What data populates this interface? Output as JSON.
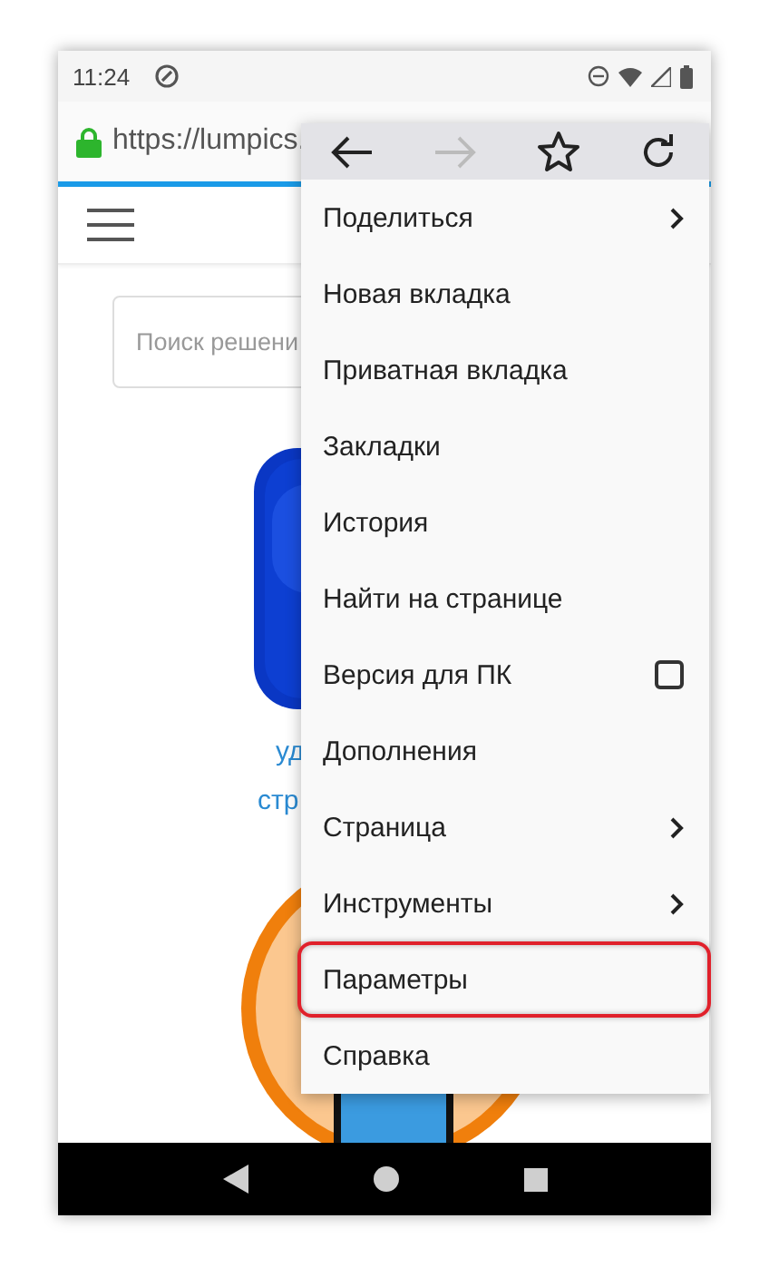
{
  "status_bar": {
    "time": "11:24"
  },
  "address_bar": {
    "url": "https://lumpics."
  },
  "page": {
    "search": {
      "placeholder": "Поиск решени"
    },
    "link_lines": [
      "уд",
      "стр"
    ]
  },
  "menu": {
    "toolbar": [
      {
        "kind": "back",
        "disabled": false
      },
      {
        "kind": "forward",
        "disabled": true
      },
      {
        "kind": "bookmark",
        "disabled": false
      },
      {
        "kind": "reload",
        "disabled": false
      }
    ],
    "items": [
      {
        "label": "Поделиться",
        "kind": "submenu",
        "highlighted": false
      },
      {
        "label": "Новая вкладка",
        "kind": "plain",
        "highlighted": false
      },
      {
        "label": "Приватная вкладка",
        "kind": "plain",
        "highlighted": false
      },
      {
        "label": "Закладки",
        "kind": "plain",
        "highlighted": false
      },
      {
        "label": "История",
        "kind": "plain",
        "highlighted": false
      },
      {
        "label": "Найти на странице",
        "kind": "plain",
        "highlighted": false
      },
      {
        "label": "Версия для ПК",
        "kind": "checkbox",
        "checked": false,
        "highlighted": false
      },
      {
        "label": "Дополнения",
        "kind": "plain",
        "highlighted": false
      },
      {
        "label": "Страница",
        "kind": "submenu",
        "highlighted": false
      },
      {
        "label": "Инструменты",
        "kind": "submenu",
        "highlighted": false
      },
      {
        "label": "Параметры",
        "kind": "plain",
        "highlighted": true
      },
      {
        "label": "Справка",
        "kind": "plain",
        "highlighted": false
      }
    ]
  }
}
